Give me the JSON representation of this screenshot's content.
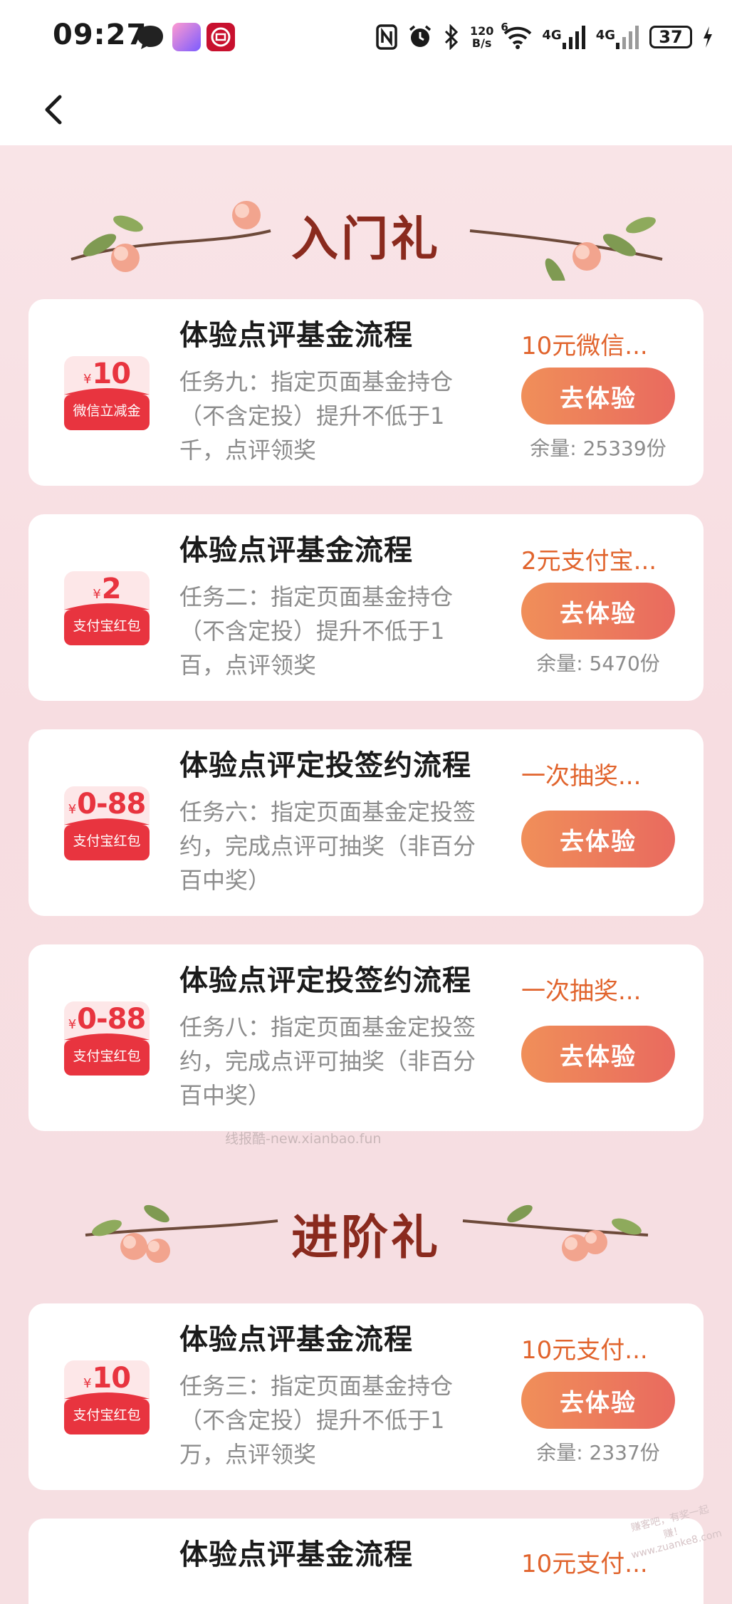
{
  "status_bar": {
    "time": "09:27",
    "speed": "120",
    "speed_unit": "B/s",
    "wifi_label": "6",
    "net1": "4G",
    "net2": "4G",
    "battery": "37"
  },
  "header": {
    "back_icon": "chevron-left-icon"
  },
  "sections": [
    {
      "title": "入门礼"
    },
    {
      "title": "进阶礼"
    }
  ],
  "watermark": "线报酷-new.xianbao.fun",
  "corner_watermark": "赚客吧，有奖一起赚！ www.zuanke8.com",
  "cards": [
    {
      "title": "体验点评基金流程",
      "desc": "任务九：指定页面基金持仓（不含定投）提升不低于1千，点评领奖",
      "reward": "10元微信...",
      "button": "去体验",
      "stock": "余量: 25339份",
      "coupon": {
        "currency": "¥",
        "amount": "10",
        "label": "微信立减金"
      }
    },
    {
      "title": "体验点评基金流程",
      "desc": "任务二：指定页面基金持仓（不含定投）提升不低于1百，点评领奖",
      "reward": "2元支付宝...",
      "button": "去体验",
      "stock": "余量: 5470份",
      "coupon": {
        "currency": "¥",
        "amount": "2",
        "label": "支付宝红包"
      }
    },
    {
      "title": "体验点评定投签约流程",
      "desc": "任务六：指定页面基金定投签约，完成点评可抽奖（非百分百中奖）",
      "reward": "一次抽奖...",
      "button": "去体验",
      "stock": "",
      "coupon": {
        "currency": "¥",
        "amount": "0-88",
        "label": "支付宝红包"
      }
    },
    {
      "title": "体验点评定投签约流程",
      "desc": "任务八：指定页面基金定投签约，完成点评可抽奖（非百分百中奖）",
      "reward": "一次抽奖...",
      "button": "去体验",
      "stock": "",
      "coupon": {
        "currency": "¥",
        "amount": "0-88",
        "label": "支付宝红包"
      }
    },
    {
      "title": "体验点评基金流程",
      "desc": "任务三：指定页面基金持仓（不含定投）提升不低于1万，点评领奖",
      "reward": "10元支付...",
      "button": "去体验",
      "stock": "余量: 2337份",
      "coupon": {
        "currency": "¥",
        "amount": "10",
        "label": "支付宝红包"
      }
    },
    {
      "title": "体验点评基金流程",
      "desc": "",
      "reward": "10元支付...",
      "button": "",
      "stock": "",
      "coupon": {
        "currency": "",
        "amount": "",
        "label": ""
      }
    }
  ]
}
